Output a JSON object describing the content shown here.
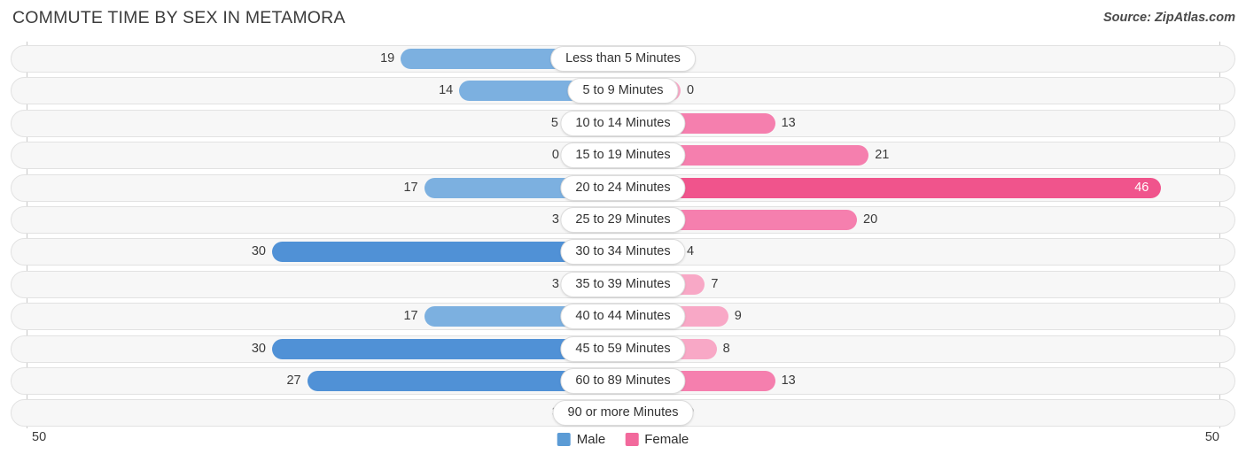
{
  "header": {
    "title": "COMMUTE TIME BY SEX IN METAMORA",
    "source": "Source: ZipAtlas.com"
  },
  "axis": {
    "left_tick": "50",
    "right_tick": "50",
    "max": 50
  },
  "legend": {
    "items": [
      {
        "label": "Male",
        "color": "#5b9bd5"
      },
      {
        "label": "Female",
        "color": "#f2699c"
      }
    ]
  },
  "colors": {
    "male_strong": "#5091d6",
    "male_mid": "#7cb0e0",
    "male_light": "#a8c9ea",
    "female_strong": "#f0548c",
    "female_mid": "#f57fae",
    "female_light": "#f8a8c6",
    "track_bg": "#f7f7f7",
    "track_border": "#e2e2e2"
  },
  "chart_data": {
    "type": "bar",
    "orientation": "horizontal-diverging",
    "title": "COMMUTE TIME BY SEX IN METAMORA",
    "xlabel": "",
    "ylabel": "",
    "xlim": [
      50,
      50
    ],
    "grid": false,
    "legend_position": "bottom-center",
    "categories": [
      "Less than 5 Minutes",
      "5 to 9 Minutes",
      "10 to 14 Minutes",
      "15 to 19 Minutes",
      "20 to 24 Minutes",
      "25 to 29 Minutes",
      "30 to 34 Minutes",
      "35 to 39 Minutes",
      "40 to 44 Minutes",
      "45 to 59 Minutes",
      "60 to 89 Minutes",
      "90 or more Minutes"
    ],
    "series": [
      {
        "name": "Male",
        "values": [
          19,
          14,
          5,
          0,
          17,
          3,
          30,
          3,
          17,
          30,
          27,
          3
        ]
      },
      {
        "name": "Female",
        "values": [
          0,
          0,
          13,
          21,
          46,
          20,
          4,
          7,
          9,
          8,
          13,
          0
        ]
      }
    ]
  },
  "rows": [
    {
      "label": "Less than 5 Minutes",
      "male": "19",
      "female": "0",
      "male_v": 19,
      "female_v": 0
    },
    {
      "label": "5 to 9 Minutes",
      "male": "14",
      "female": "0",
      "male_v": 14,
      "female_v": 0
    },
    {
      "label": "10 to 14 Minutes",
      "male": "5",
      "female": "13",
      "male_v": 5,
      "female_v": 13
    },
    {
      "label": "15 to 19 Minutes",
      "male": "0",
      "female": "21",
      "male_v": 0,
      "female_v": 21
    },
    {
      "label": "20 to 24 Minutes",
      "male": "17",
      "female": "46",
      "male_v": 17,
      "female_v": 46
    },
    {
      "label": "25 to 29 Minutes",
      "male": "3",
      "female": "20",
      "male_v": 3,
      "female_v": 20
    },
    {
      "label": "30 to 34 Minutes",
      "male": "30",
      "female": "4",
      "male_v": 30,
      "female_v": 4
    },
    {
      "label": "35 to 39 Minutes",
      "male": "3",
      "female": "7",
      "male_v": 3,
      "female_v": 7
    },
    {
      "label": "40 to 44 Minutes",
      "male": "17",
      "female": "9",
      "male_v": 17,
      "female_v": 9
    },
    {
      "label": "45 to 59 Minutes",
      "male": "30",
      "female": "8",
      "male_v": 30,
      "female_v": 8
    },
    {
      "label": "60 to 89 Minutes",
      "male": "27",
      "female": "13",
      "male_v": 27,
      "female_v": 13
    },
    {
      "label": "90 or more Minutes",
      "male": "3",
      "female": "0",
      "male_v": 3,
      "female_v": 0
    }
  ]
}
